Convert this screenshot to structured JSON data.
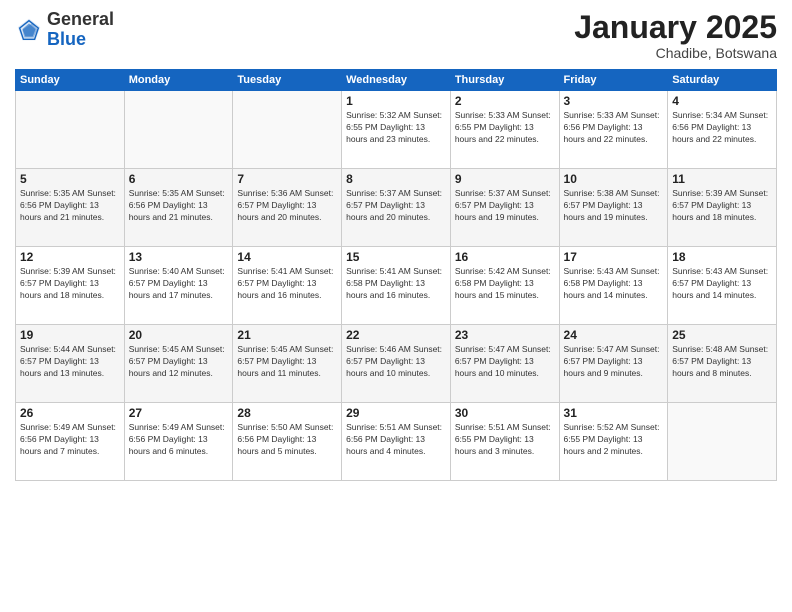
{
  "logo": {
    "general": "General",
    "blue": "Blue"
  },
  "header": {
    "month": "January 2025",
    "location": "Chadibe, Botswana"
  },
  "weekdays": [
    "Sunday",
    "Monday",
    "Tuesday",
    "Wednesday",
    "Thursday",
    "Friday",
    "Saturday"
  ],
  "weeks": [
    [
      {
        "day": "",
        "info": ""
      },
      {
        "day": "",
        "info": ""
      },
      {
        "day": "",
        "info": ""
      },
      {
        "day": "1",
        "info": "Sunrise: 5:32 AM\nSunset: 6:55 PM\nDaylight: 13 hours\nand 23 minutes."
      },
      {
        "day": "2",
        "info": "Sunrise: 5:33 AM\nSunset: 6:55 PM\nDaylight: 13 hours\nand 22 minutes."
      },
      {
        "day": "3",
        "info": "Sunrise: 5:33 AM\nSunset: 6:56 PM\nDaylight: 13 hours\nand 22 minutes."
      },
      {
        "day": "4",
        "info": "Sunrise: 5:34 AM\nSunset: 6:56 PM\nDaylight: 13 hours\nand 22 minutes."
      }
    ],
    [
      {
        "day": "5",
        "info": "Sunrise: 5:35 AM\nSunset: 6:56 PM\nDaylight: 13 hours\nand 21 minutes."
      },
      {
        "day": "6",
        "info": "Sunrise: 5:35 AM\nSunset: 6:56 PM\nDaylight: 13 hours\nand 21 minutes."
      },
      {
        "day": "7",
        "info": "Sunrise: 5:36 AM\nSunset: 6:57 PM\nDaylight: 13 hours\nand 20 minutes."
      },
      {
        "day": "8",
        "info": "Sunrise: 5:37 AM\nSunset: 6:57 PM\nDaylight: 13 hours\nand 20 minutes."
      },
      {
        "day": "9",
        "info": "Sunrise: 5:37 AM\nSunset: 6:57 PM\nDaylight: 13 hours\nand 19 minutes."
      },
      {
        "day": "10",
        "info": "Sunrise: 5:38 AM\nSunset: 6:57 PM\nDaylight: 13 hours\nand 19 minutes."
      },
      {
        "day": "11",
        "info": "Sunrise: 5:39 AM\nSunset: 6:57 PM\nDaylight: 13 hours\nand 18 minutes."
      }
    ],
    [
      {
        "day": "12",
        "info": "Sunrise: 5:39 AM\nSunset: 6:57 PM\nDaylight: 13 hours\nand 18 minutes."
      },
      {
        "day": "13",
        "info": "Sunrise: 5:40 AM\nSunset: 6:57 PM\nDaylight: 13 hours\nand 17 minutes."
      },
      {
        "day": "14",
        "info": "Sunrise: 5:41 AM\nSunset: 6:57 PM\nDaylight: 13 hours\nand 16 minutes."
      },
      {
        "day": "15",
        "info": "Sunrise: 5:41 AM\nSunset: 6:58 PM\nDaylight: 13 hours\nand 16 minutes."
      },
      {
        "day": "16",
        "info": "Sunrise: 5:42 AM\nSunset: 6:58 PM\nDaylight: 13 hours\nand 15 minutes."
      },
      {
        "day": "17",
        "info": "Sunrise: 5:43 AM\nSunset: 6:58 PM\nDaylight: 13 hours\nand 14 minutes."
      },
      {
        "day": "18",
        "info": "Sunrise: 5:43 AM\nSunset: 6:57 PM\nDaylight: 13 hours\nand 14 minutes."
      }
    ],
    [
      {
        "day": "19",
        "info": "Sunrise: 5:44 AM\nSunset: 6:57 PM\nDaylight: 13 hours\nand 13 minutes."
      },
      {
        "day": "20",
        "info": "Sunrise: 5:45 AM\nSunset: 6:57 PM\nDaylight: 13 hours\nand 12 minutes."
      },
      {
        "day": "21",
        "info": "Sunrise: 5:45 AM\nSunset: 6:57 PM\nDaylight: 13 hours\nand 11 minutes."
      },
      {
        "day": "22",
        "info": "Sunrise: 5:46 AM\nSunset: 6:57 PM\nDaylight: 13 hours\nand 10 minutes."
      },
      {
        "day": "23",
        "info": "Sunrise: 5:47 AM\nSunset: 6:57 PM\nDaylight: 13 hours\nand 10 minutes."
      },
      {
        "day": "24",
        "info": "Sunrise: 5:47 AM\nSunset: 6:57 PM\nDaylight: 13 hours\nand 9 minutes."
      },
      {
        "day": "25",
        "info": "Sunrise: 5:48 AM\nSunset: 6:57 PM\nDaylight: 13 hours\nand 8 minutes."
      }
    ],
    [
      {
        "day": "26",
        "info": "Sunrise: 5:49 AM\nSunset: 6:56 PM\nDaylight: 13 hours\nand 7 minutes."
      },
      {
        "day": "27",
        "info": "Sunrise: 5:49 AM\nSunset: 6:56 PM\nDaylight: 13 hours\nand 6 minutes."
      },
      {
        "day": "28",
        "info": "Sunrise: 5:50 AM\nSunset: 6:56 PM\nDaylight: 13 hours\nand 5 minutes."
      },
      {
        "day": "29",
        "info": "Sunrise: 5:51 AM\nSunset: 6:56 PM\nDaylight: 13 hours\nand 4 minutes."
      },
      {
        "day": "30",
        "info": "Sunrise: 5:51 AM\nSunset: 6:55 PM\nDaylight: 13 hours\nand 3 minutes."
      },
      {
        "day": "31",
        "info": "Sunrise: 5:52 AM\nSunset: 6:55 PM\nDaylight: 13 hours\nand 2 minutes."
      },
      {
        "day": "",
        "info": ""
      }
    ]
  ]
}
